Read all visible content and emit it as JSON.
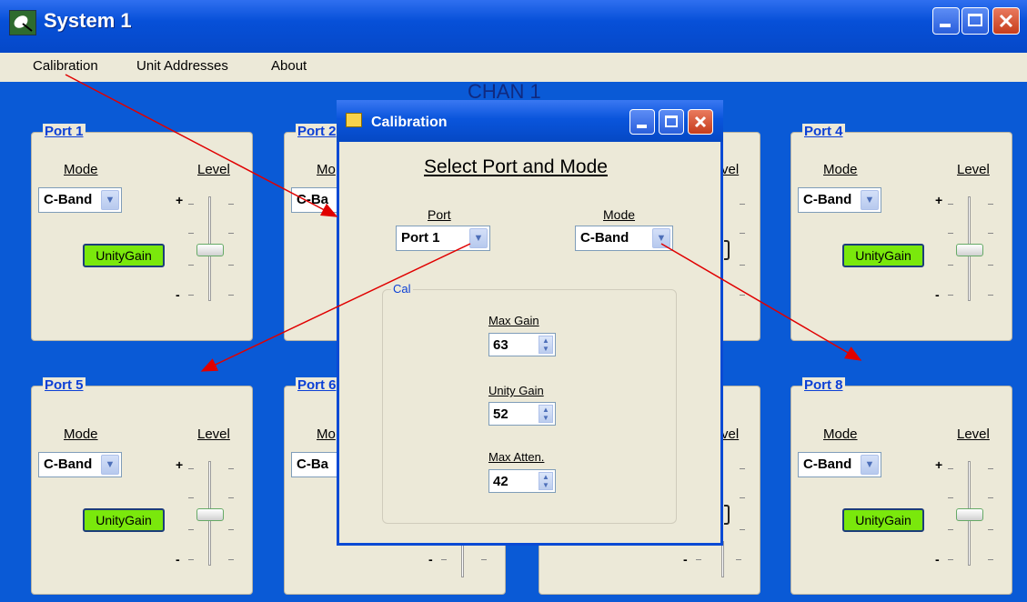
{
  "window": {
    "title": "System 1",
    "icon": "satellite-dish-icon"
  },
  "menu": {
    "items": [
      "Calibration",
      "Unit Addresses",
      "About"
    ]
  },
  "chan_header": "CHAN 1",
  "panel_common": {
    "mode_label": "Mode",
    "level_label": "Level",
    "mode_value": "C-Band",
    "mode_value_partial": "C-Ba",
    "mode_label_partial": "Mo",
    "level_label_partial": "vel",
    "unity_label": "UnityGain",
    "plus": "+",
    "minus": "-"
  },
  "ports": {
    "p1": "Port 1",
    "p2": "Port 2",
    "p4": "Port 4",
    "p5": "Port 5",
    "p6": "Port 6",
    "p8": "Port 8"
  },
  "dialog": {
    "title": "Calibration",
    "heading": "Select Port and Mode",
    "port_label": "Port",
    "port_value": "Port 1",
    "mode_label": "Mode",
    "mode_value": "C-Band",
    "cal_group": "Cal",
    "max_gain_label": "Max Gain",
    "max_gain_value": "63",
    "unity_gain_label": "Unity Gain",
    "unity_gain_value": "52",
    "max_atten_label": "Max Atten.",
    "max_atten_value": "42"
  },
  "colors": {
    "background": "#0a5ad6",
    "title_bar": "#0548c8",
    "panel": "#ece9d8",
    "unity_button": "#7ae80c",
    "port_label": "#0b3fd6",
    "annotation_arrow": "#e00000"
  }
}
